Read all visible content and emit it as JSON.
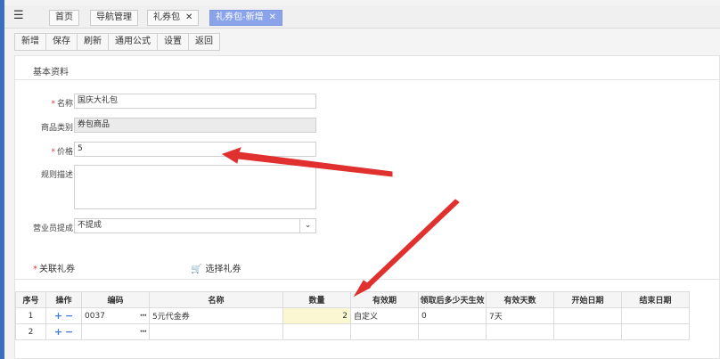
{
  "tabs": [
    {
      "label": "首页",
      "closable": false,
      "active": false
    },
    {
      "label": "导航管理",
      "closable": false,
      "active": false
    },
    {
      "label": "礼券包",
      "closable": true,
      "active": false
    },
    {
      "label": "礼券包-新增",
      "closable": true,
      "active": true
    }
  ],
  "toolbar": {
    "buttons": [
      "新增",
      "保存",
      "刷新",
      "通用公式",
      "设置",
      "返回"
    ]
  },
  "form": {
    "section_title": "基本资料",
    "name": {
      "label": "名称:",
      "value": "国庆大礼包",
      "required": true
    },
    "category": {
      "label": "商品类别:",
      "value": "券包商品"
    },
    "price": {
      "label": "价格:",
      "value": "5",
      "required": true
    },
    "description": {
      "label": "规则描述:",
      "value": ""
    },
    "commission": {
      "label": "营业员提成:",
      "value": "不提成"
    }
  },
  "related": {
    "label": "关联礼券",
    "choose_label": "选择礼券"
  },
  "grid": {
    "headers": [
      "序号",
      "操作",
      "编码",
      "名称",
      "数量",
      "有效期",
      "领取后多少天生效",
      "有效天数",
      "开始日期",
      "结束日期"
    ],
    "rows": [
      {
        "no": "1",
        "code": "0037",
        "name": "5元代金券",
        "qty": "2",
        "validity": "自定义",
        "effective_after": "0",
        "valid_days": "7天",
        "start": "",
        "end": ""
      },
      {
        "no": "2",
        "code": "",
        "name": "",
        "qty": "",
        "validity": "",
        "effective_after": "",
        "valid_days": "",
        "start": "",
        "end": ""
      }
    ]
  },
  "colors": {
    "accent": "#8aa3ea",
    "left_strip": "#3a6fc4",
    "annotation_arrow": "#e0312f",
    "qty_highlight": "#fbf7d3"
  }
}
